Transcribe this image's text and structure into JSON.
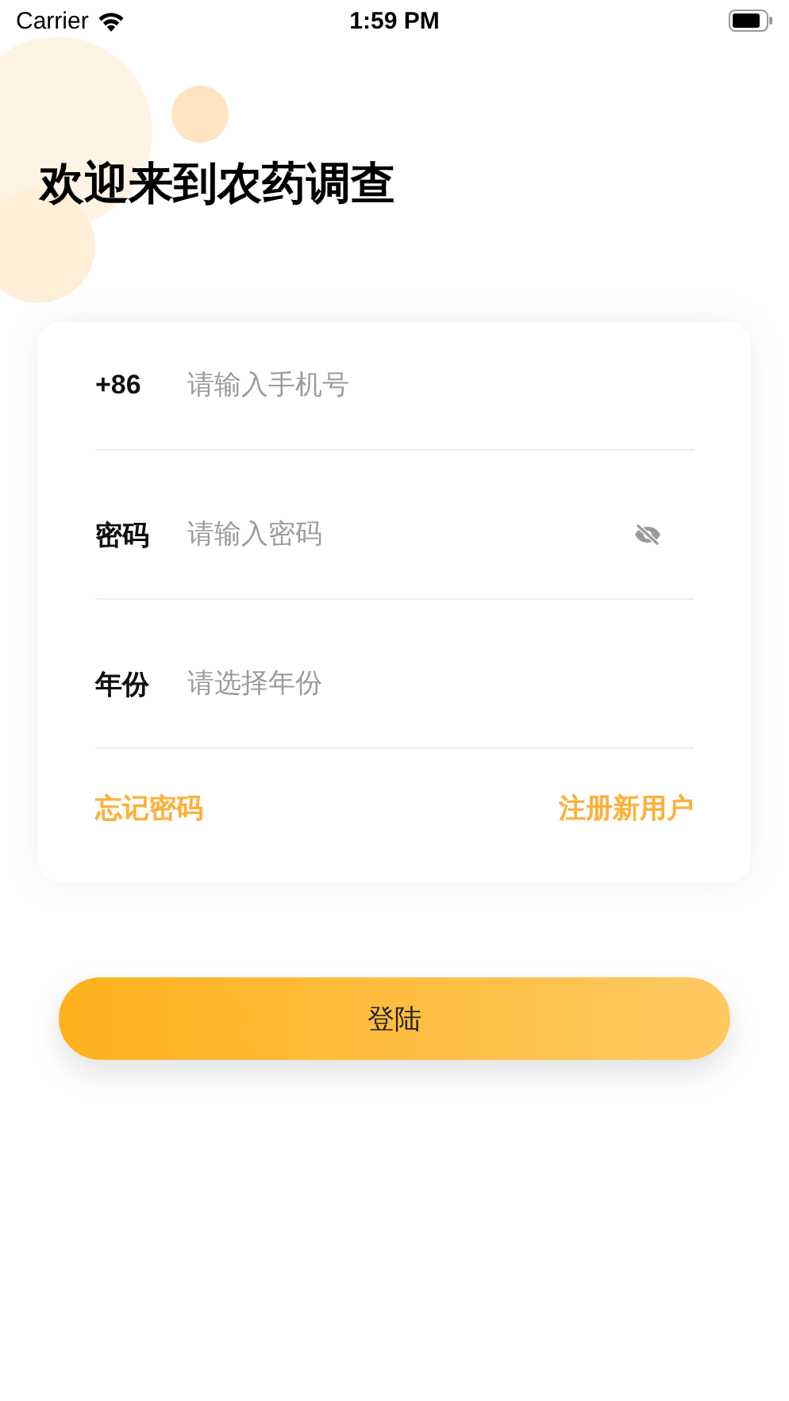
{
  "status_bar": {
    "carrier": "Carrier",
    "time": "1:59 PM"
  },
  "title": "欢迎来到农药调查",
  "form": {
    "fields": [
      {
        "kind": "phone",
        "label": "+86",
        "placeholder": "请输入手机号"
      },
      {
        "kind": "password",
        "label": "密码",
        "placeholder": "请输入密码"
      },
      {
        "kind": "select",
        "label": "年份",
        "placeholder": "请选择年份"
      }
    ],
    "links": [
      "忘记密码",
      "注册新用户"
    ]
  },
  "login_button": "登陆"
}
